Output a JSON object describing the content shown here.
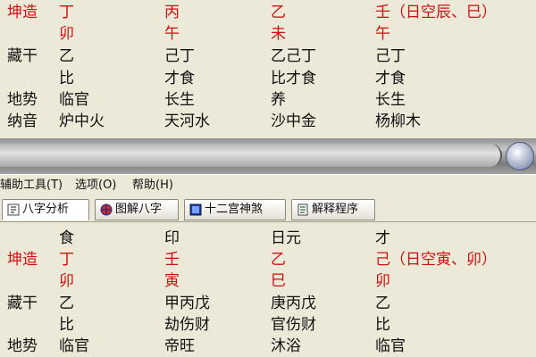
{
  "top_chart": {
    "rows": [
      {
        "label": "坤造",
        "cells": [
          "丁",
          "丙",
          "乙",
          "壬（日空辰、巳）"
        ],
        "red": true
      },
      {
        "label": "",
        "cells": [
          "卯",
          "午",
          "未",
          "午"
        ],
        "red": true
      },
      {
        "label": "藏干",
        "cells": [
          "乙",
          "己丁",
          "乙己丁",
          "己丁"
        ],
        "red": false
      },
      {
        "label": "",
        "cells": [
          "比",
          "才食",
          "比才食",
          "才食"
        ],
        "red": false
      },
      {
        "label": "地势",
        "cells": [
          "临官",
          "长生",
          "养",
          "长生"
        ],
        "red": false
      },
      {
        "label": "纳音",
        "cells": [
          "炉中火",
          "天河水",
          "沙中金",
          "杨柳木"
        ],
        "red": false
      }
    ]
  },
  "menu": {
    "items": [
      {
        "label": "辅助工具(T)"
      },
      {
        "label": "选项(O)"
      },
      {
        "label": "帮助(H)"
      }
    ]
  },
  "tabs": [
    {
      "label": "八字分析",
      "icon": "bazi-icon",
      "active": true
    },
    {
      "label": "图解八字",
      "icon": "chart-icon",
      "active": false
    },
    {
      "label": "十二宫神煞",
      "icon": "grid-icon",
      "active": false
    },
    {
      "label": "解释程序",
      "icon": "document-icon",
      "active": false
    }
  ],
  "bottom_chart": {
    "rows": [
      {
        "label": "",
        "cells": [
          "食",
          "印",
          "日元",
          "才"
        ],
        "red": false
      },
      {
        "label": "坤造",
        "cells": [
          "丁",
          "壬",
          "乙",
          "己（日空寅、卯）"
        ],
        "red": true
      },
      {
        "label": "",
        "cells": [
          "卯",
          "寅",
          "巳",
          "卯"
        ],
        "red": true
      },
      {
        "label": "藏干",
        "cells": [
          "乙",
          "甲丙戊",
          "庚丙戊",
          "乙"
        ],
        "red": false
      },
      {
        "label": "",
        "cells": [
          "比",
          "劫伤财",
          "官伤财",
          "比"
        ],
        "red": false
      },
      {
        "label": "地势",
        "cells": [
          "临官",
          "帝旺",
          "沐浴",
          "临官"
        ],
        "red": false
      }
    ]
  },
  "colors": {
    "stem_branch": "#d01010",
    "text": "#111111",
    "window_bg": "#ece9d8"
  }
}
